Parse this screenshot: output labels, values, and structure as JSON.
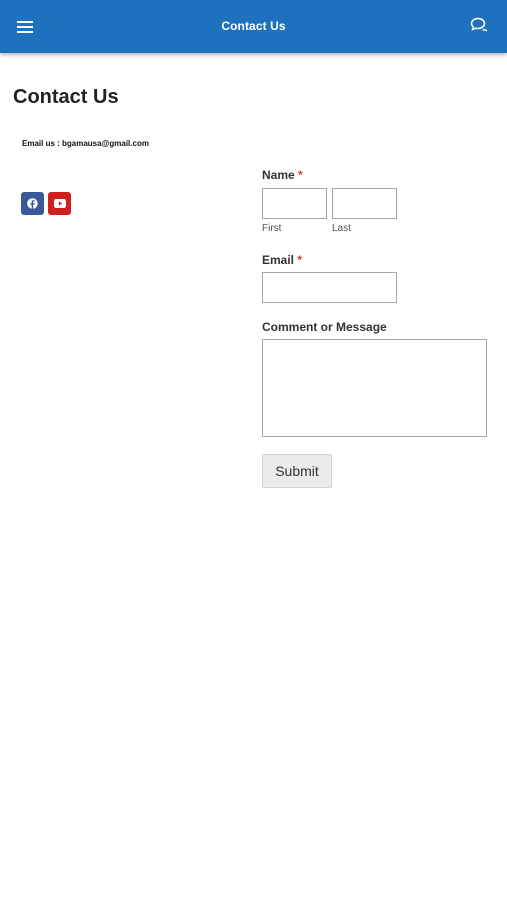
{
  "appbar": {
    "title": "Contact Us",
    "menu_icon": "hamburger-menu-icon",
    "chat_icon": "chat-bubbles-icon",
    "color": "#1e72bd"
  },
  "page": {
    "title": "Contact Us",
    "email_line": "Email us : bgamausa@gmail.com"
  },
  "social": [
    {
      "name": "facebook-icon",
      "color": "#3b5998"
    },
    {
      "name": "youtube-icon",
      "color": "#cd201f"
    }
  ],
  "form": {
    "name_label": "Name",
    "required_mark": "*",
    "first_sublabel": "First",
    "last_sublabel": "Last",
    "first_value": "",
    "last_value": "",
    "email_label": "Email",
    "email_value": "",
    "comment_label": "Comment or Message",
    "comment_value": "",
    "submit_label": "Submit"
  }
}
